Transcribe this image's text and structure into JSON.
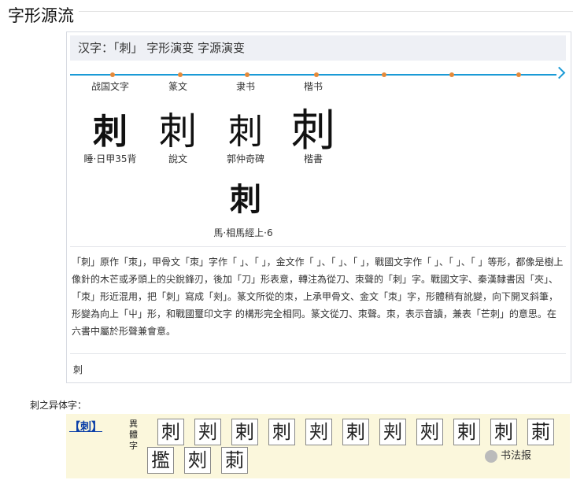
{
  "page_title": "字形源流",
  "card": {
    "header": "汉字：「刺」 字形演变 字源演变",
    "eras": [
      {
        "label": "战国文字",
        "glyph": "刺",
        "caption": "睡·日甲35背"
      },
      {
        "label": "篆文",
        "glyph": "刺",
        "caption": "說文"
      },
      {
        "label": "隶书",
        "glyph": "刺",
        "caption": "郭仲奇碑"
      },
      {
        "label": "楷书",
        "glyph": "刺",
        "caption": "楷書"
      }
    ],
    "extra": {
      "glyph": "刺",
      "caption": "馬·相馬經上·6"
    },
    "description": "「刺」原作「朿」，甲骨文「朿」字作「 」、「 」，金文作「 」、「 」、「 」，戰國文字作「 」、「 」、「 」等形，都像是樹上像針的木芒或矛頭上的尖銳鋒刃，後加「刀」形表意，轉注為從刀、朿聲的「刺」字。戰國文字、秦漢隸書因「夾」、「朿」形近混用，把「刺」寫成「刾」。篆文所從的朿，上承甲骨文、金文「朿」字，形體稍有訛變，向下開叉斜筆，形變為向上「屮」形，和戰國璽印文字 的構形完全相同。篆文從刀、朿聲。朿，表示音讀，兼表「芒刺」的意思。在六書中屬於形聲兼會意。",
    "footer_char": "刺"
  },
  "variants": {
    "title": "刺之异体字：",
    "link": "【刺】",
    "label": "異體字",
    "chars": [
      "刺",
      "刾",
      "剌",
      "刺",
      "刾",
      "剌",
      "刾",
      "㓨",
      "剌",
      "刺",
      "莿",
      "㩜",
      "㓨",
      "莿"
    ]
  },
  "watermark": "书法报"
}
